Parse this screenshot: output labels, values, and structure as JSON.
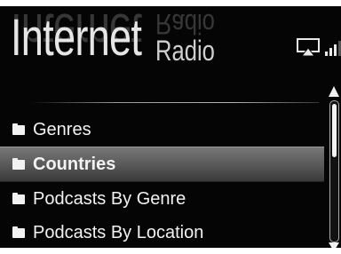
{
  "header": {
    "title_word1": "Internet",
    "title_word2": "Radio"
  },
  "status": {
    "airplay_icon": "airplay-icon",
    "signal_icon": "signal-strength-icon",
    "signal_bars_level": 3
  },
  "list": {
    "items": [
      {
        "label": "Genres",
        "icon": "folder-icon",
        "selected": false
      },
      {
        "label": "Countries",
        "icon": "folder-icon",
        "selected": true
      },
      {
        "label": "Podcasts By Genre",
        "icon": "folder-icon",
        "selected": false
      },
      {
        "label": "Podcasts By Location",
        "icon": "folder-icon",
        "selected": false
      }
    ]
  },
  "colors": {
    "background": "#050505",
    "text": "#f2f2f2",
    "selection": "#5a5a5a"
  }
}
